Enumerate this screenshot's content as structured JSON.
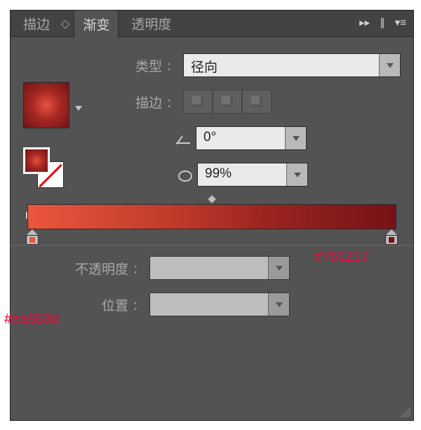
{
  "tabs": {
    "stroke": "描边",
    "gradient": "渐变",
    "transparency": "透明度"
  },
  "labels": {
    "type": "类型",
    "stroke": "描边",
    "opacity": "不透明度",
    "location": "位置",
    "colon": "："
  },
  "type": {
    "value": "径向"
  },
  "angle": {
    "value": "0°"
  },
  "aspect": {
    "value": "99%"
  },
  "gradient": {
    "stops": [
      {
        "pos": 0,
        "color": "#ea563d"
      },
      {
        "pos": 100,
        "color": "#761217"
      }
    ],
    "annot_left": "#ea563d",
    "annot_right": "#761217"
  },
  "opacity": {
    "value": ""
  },
  "location": {
    "value": ""
  },
  "icons": {
    "swatch": "gradient-swatch",
    "fill": "fill-swatch",
    "strokeSwatch": "stroke-swatch",
    "swap": "swap-fill-stroke",
    "angle": "angle-icon",
    "aspect": "aspect-ratio-icon",
    "trash": "trash-icon",
    "fastforward": "collapse-icon",
    "splitter": "dock-icon",
    "menu": "panel-menu-icon"
  }
}
